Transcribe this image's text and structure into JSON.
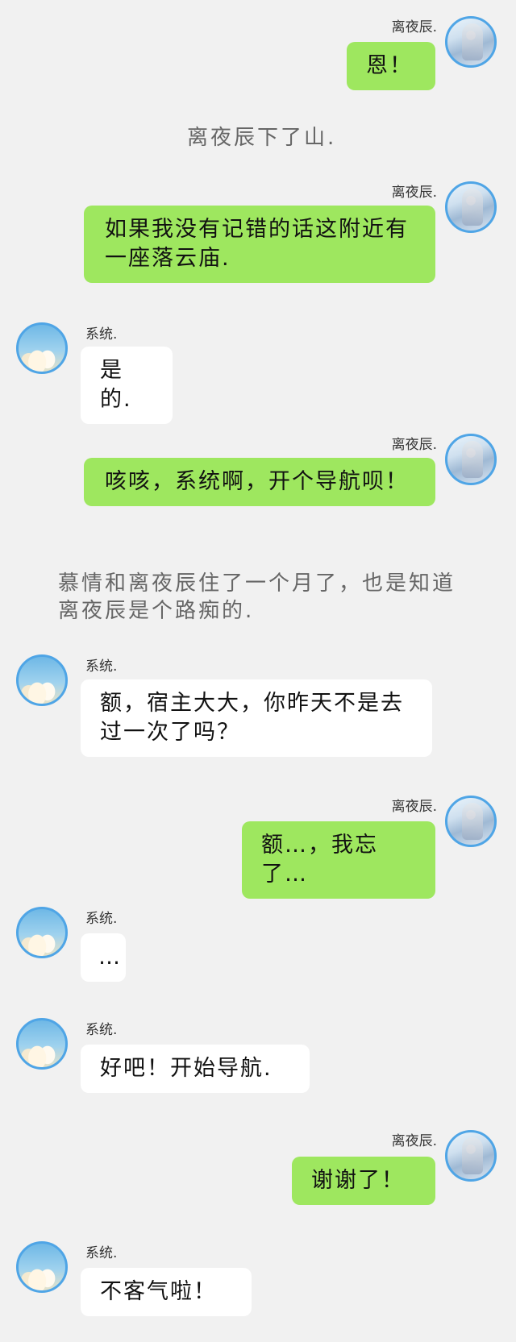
{
  "participants": {
    "user_name": "离夜辰.",
    "system_name": "系统."
  },
  "messages": [
    {
      "text": "恩！"
    },
    {
      "text": "离夜辰下了山."
    },
    {
      "text": "如果我没有记错的话这附近有一座落云庙."
    },
    {
      "text": "是的."
    },
    {
      "text": "咳咳，系统啊，开个导航呗！"
    },
    {
      "text": "慕情和离夜辰住了一个月了，也是知道离夜辰是个路痴的."
    },
    {
      "text": "额，宿主大大，你昨天不是去过一次了吗？"
    },
    {
      "text": "额…，我忘了…"
    },
    {
      "text": "…"
    },
    {
      "text": "好吧！开始导航."
    },
    {
      "text": "谢谢了！"
    },
    {
      "text": "不客气啦！"
    }
  ]
}
